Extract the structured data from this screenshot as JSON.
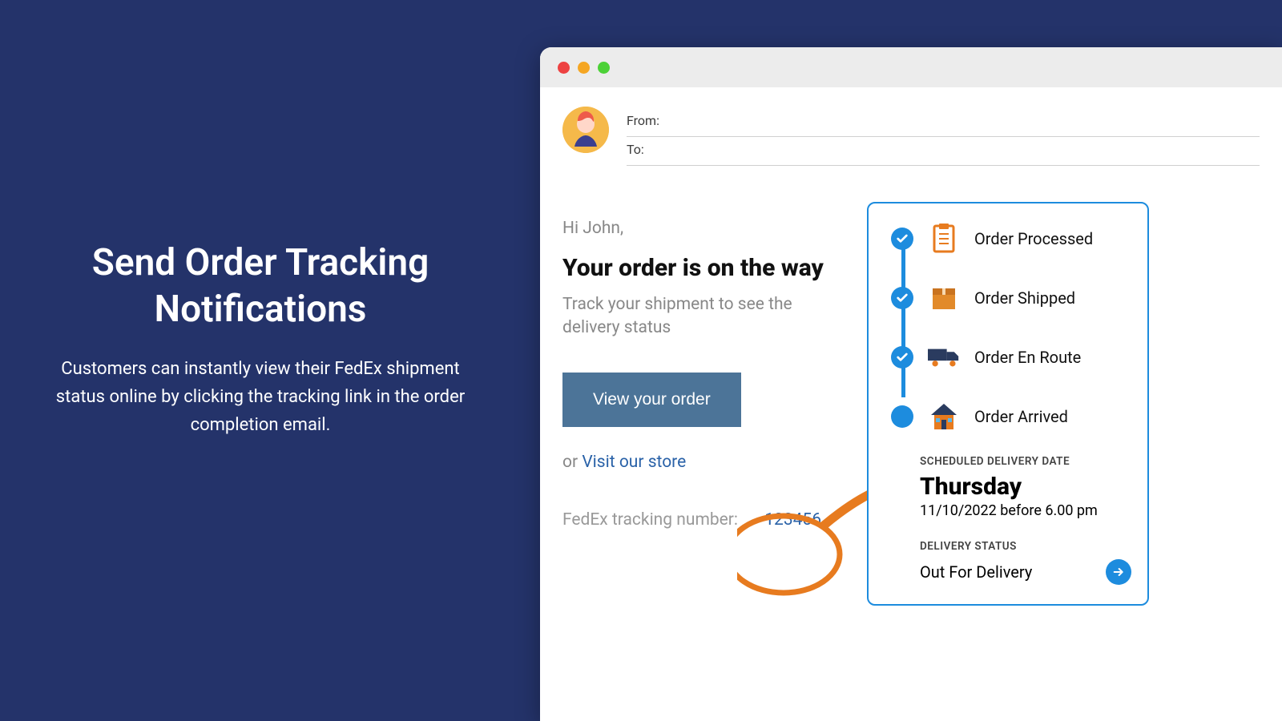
{
  "marketing": {
    "heading": "Send Order Tracking Notifications",
    "body": "Customers can instantly view their FedEx shipment status online by clicking the tracking link in the order completion email."
  },
  "email": {
    "from_label": "From:",
    "to_label": "To:",
    "greeting": "Hi John,",
    "headline": "Your order is on the way",
    "subtext": "Track your shipment to see the delivery status",
    "cta": "View your order",
    "or_text": "or ",
    "store_link": "Visit our store",
    "tracking_label": "FedEx tracking number:",
    "tracking_number": "123456"
  },
  "tracking": {
    "steps": [
      {
        "label": "Order Processed",
        "done": true
      },
      {
        "label": "Order Shipped",
        "done": true
      },
      {
        "label": "Order En Route",
        "done": true
      },
      {
        "label": "Order Arrived",
        "done": false
      }
    ],
    "scheduled_label": "SCHEDULED DELIVERY DATE",
    "day": "Thursday",
    "date": "11/10/2022 before 6.00 pm",
    "status_label": "DELIVERY STATUS",
    "status": "Out For Delivery"
  }
}
